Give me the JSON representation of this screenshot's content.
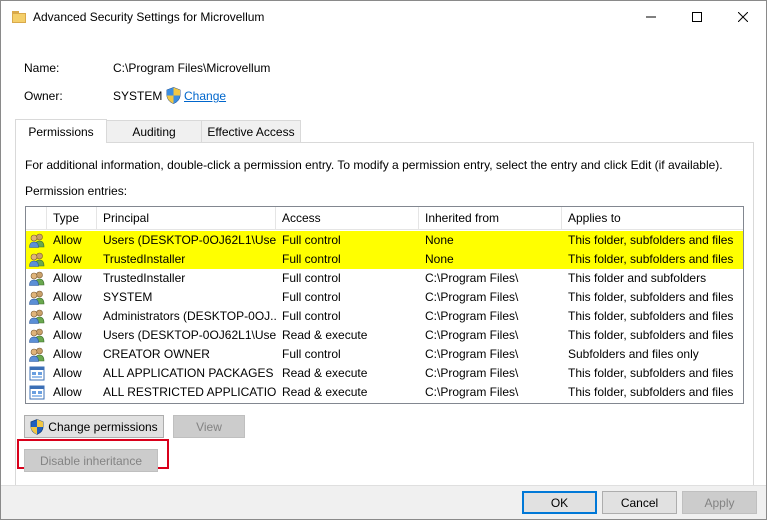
{
  "window": {
    "title": "Advanced Security Settings for Microvellum",
    "minimize": "—",
    "maximize": "☐",
    "close": "✕"
  },
  "info": {
    "name_label": "Name:",
    "name_value": "C:\\Program Files\\Microvellum",
    "owner_label": "Owner:",
    "owner_value": "SYSTEM",
    "change_link": "Change"
  },
  "tabs": [
    {
      "label": "Permissions",
      "active": true
    },
    {
      "label": "Auditing",
      "active": false
    },
    {
      "label": "Effective Access",
      "active": false
    }
  ],
  "permissions": {
    "info_text": "For additional information, double-click a permission entry. To modify a permission entry, select the entry and click Edit (if available).",
    "entries_label": "Permission entries:",
    "columns": [
      "Type",
      "Principal",
      "Access",
      "Inherited from",
      "Applies to"
    ],
    "rows": [
      {
        "icon": "users-icon",
        "type": "Allow",
        "principal": "Users (DESKTOP-0OJ62L1\\Use...",
        "access": "Full control",
        "inherited": "None",
        "applies": "This folder, subfolders and files",
        "highlight": true
      },
      {
        "icon": "users-icon",
        "type": "Allow",
        "principal": "TrustedInstaller",
        "access": "Full control",
        "inherited": "None",
        "applies": "This folder, subfolders and files",
        "highlight": true
      },
      {
        "icon": "users-icon",
        "type": "Allow",
        "principal": "TrustedInstaller",
        "access": "Full control",
        "inherited": "C:\\Program Files\\",
        "applies": "This folder and subfolders",
        "highlight": false
      },
      {
        "icon": "users-icon",
        "type": "Allow",
        "principal": "SYSTEM",
        "access": "Full control",
        "inherited": "C:\\Program Files\\",
        "applies": "This folder, subfolders and files",
        "highlight": false
      },
      {
        "icon": "users-icon",
        "type": "Allow",
        "principal": "Administrators (DESKTOP-0OJ...",
        "access": "Full control",
        "inherited": "C:\\Program Files\\",
        "applies": "This folder, subfolders and files",
        "highlight": false
      },
      {
        "icon": "users-icon",
        "type": "Allow",
        "principal": "Users (DESKTOP-0OJ62L1\\Use...",
        "access": "Read & execute",
        "inherited": "C:\\Program Files\\",
        "applies": "This folder, subfolders and files",
        "highlight": false
      },
      {
        "icon": "users-icon",
        "type": "Allow",
        "principal": "CREATOR OWNER",
        "access": "Full control",
        "inherited": "C:\\Program Files\\",
        "applies": "Subfolders and files only",
        "highlight": false
      },
      {
        "icon": "app-package-icon",
        "type": "Allow",
        "principal": "ALL APPLICATION PACKAGES",
        "access": "Read & execute",
        "inherited": "C:\\Program Files\\",
        "applies": "This folder, subfolders and files",
        "highlight": false
      },
      {
        "icon": "app-package-icon",
        "type": "Allow",
        "principal": "ALL RESTRICTED APPLICATIO...",
        "access": "Read & execute",
        "inherited": "C:\\Program Files\\",
        "applies": "This folder, subfolders and files",
        "highlight": false
      }
    ]
  },
  "buttons": {
    "change_permissions": "Change permissions",
    "view": "View",
    "disable_inheritance": "Disable inheritance",
    "ok": "OK",
    "cancel": "Cancel",
    "apply": "Apply"
  },
  "colors": {
    "highlight": "#ffff00",
    "callout": "#d9001b",
    "link": "#0066cc"
  }
}
